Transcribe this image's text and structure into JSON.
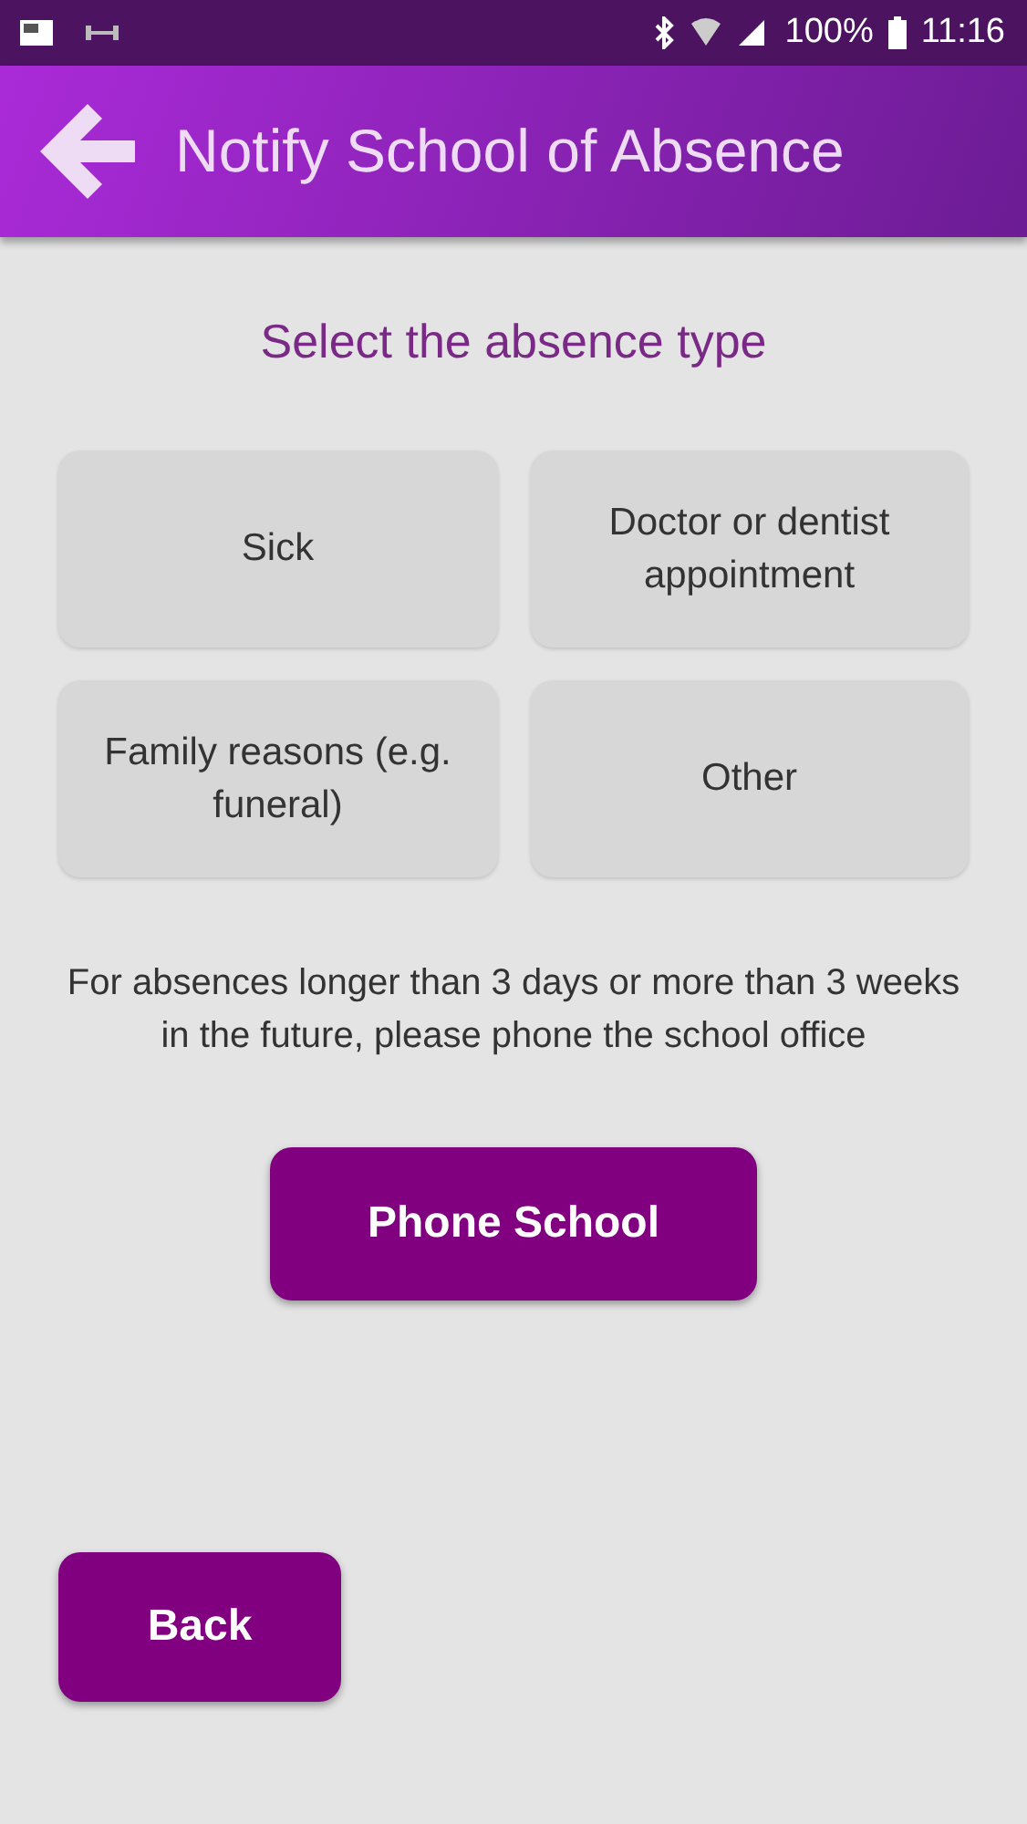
{
  "status_bar": {
    "battery": "100%",
    "time": "11:16"
  },
  "header": {
    "title": "Notify School of Absence"
  },
  "prompt": "Select the absence type",
  "absence_types": [
    {
      "label": "Sick"
    },
    {
      "label": "Doctor or dentist appointment"
    },
    {
      "label": "Family reasons (e.g. funeral)"
    },
    {
      "label": "Other"
    }
  ],
  "note": "For absences longer than 3 days or more than 3 weeks in the future, please phone the school office",
  "phone_button": "Phone School",
  "back_button": "Back"
}
